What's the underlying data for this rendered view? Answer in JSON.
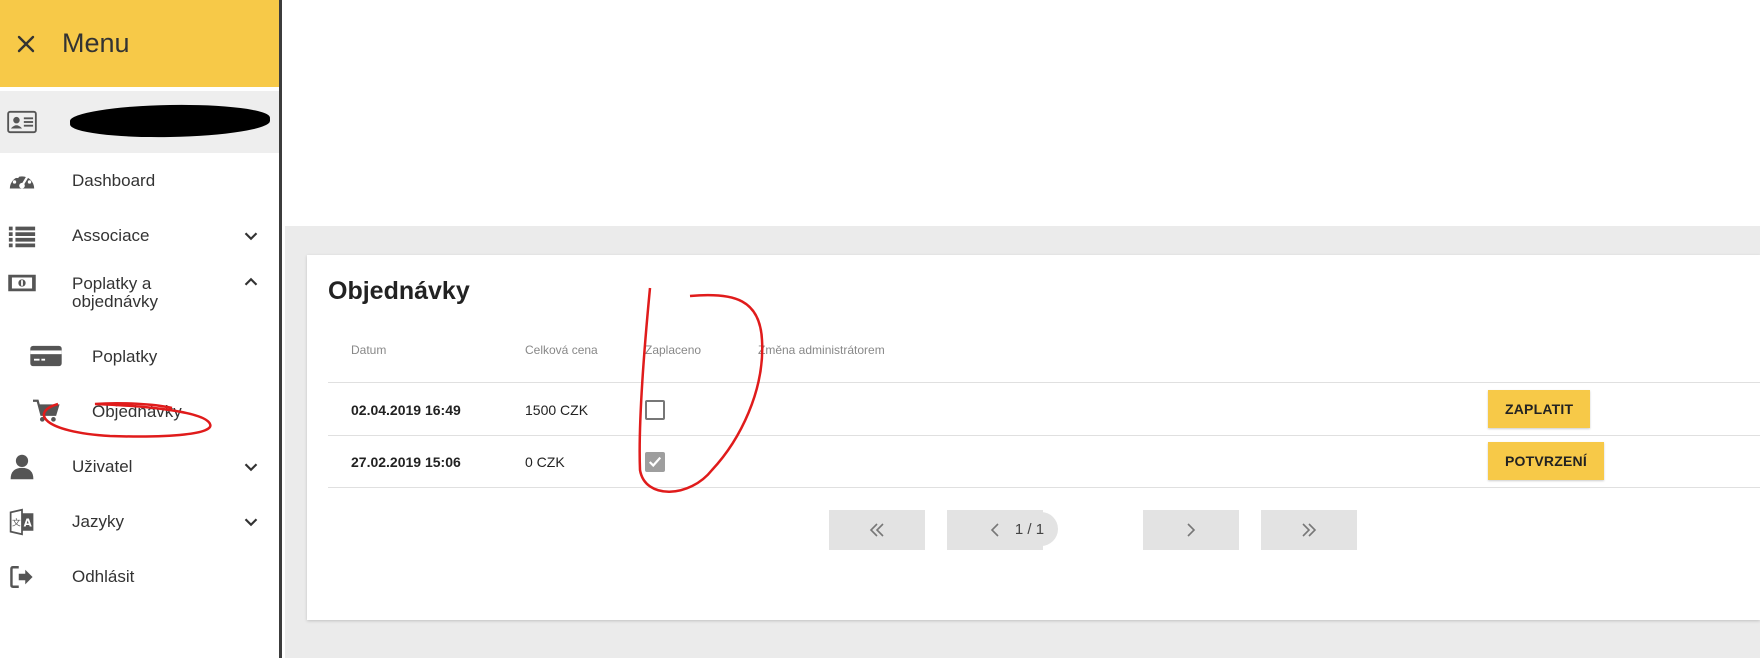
{
  "sidebar": {
    "title": "Menu",
    "close_icon": "close-icon",
    "user_name_redacted": "",
    "items": [
      {
        "label": "Dashboard",
        "icon": "dashboard-gauge-icon"
      },
      {
        "label": "Associace",
        "icon": "list-icon",
        "expanded": false
      },
      {
        "label": "Poplatky a\nobjednávky",
        "icon": "money-icon",
        "expanded": true
      },
      {
        "label": "Uživatel",
        "icon": "user-icon",
        "expanded": false
      },
      {
        "label": "Jazyky",
        "icon": "language-icon",
        "expanded": false
      },
      {
        "label": "Odhlásit",
        "icon": "logout-icon"
      }
    ],
    "subitems": [
      {
        "label": "Poplatky",
        "icon": "credit-card-icon"
      },
      {
        "label": "Objednávky",
        "icon": "cart-icon"
      }
    ]
  },
  "card": {
    "title": "Objednávky",
    "columns": [
      "Datum",
      "Celková cena",
      "Zaplaceno",
      "Změna administrátorem"
    ],
    "rows": [
      {
        "datum": "02.04.2019  16:49",
        "cena": "1500 CZK",
        "zaplaceno": false,
        "action": "ZAPLATIT"
      },
      {
        "datum": "27.02.2019  15:06",
        "cena": "0 CZK",
        "zaplaceno": true,
        "action": "POTVRZENÍ"
      }
    ],
    "pagination": {
      "current_page": 1,
      "total_pages": 1,
      "info": "1 / 1"
    }
  },
  "colors": {
    "accent": "#f7c948",
    "annotation": "#e01b1b",
    "background": "#ebebeb"
  }
}
